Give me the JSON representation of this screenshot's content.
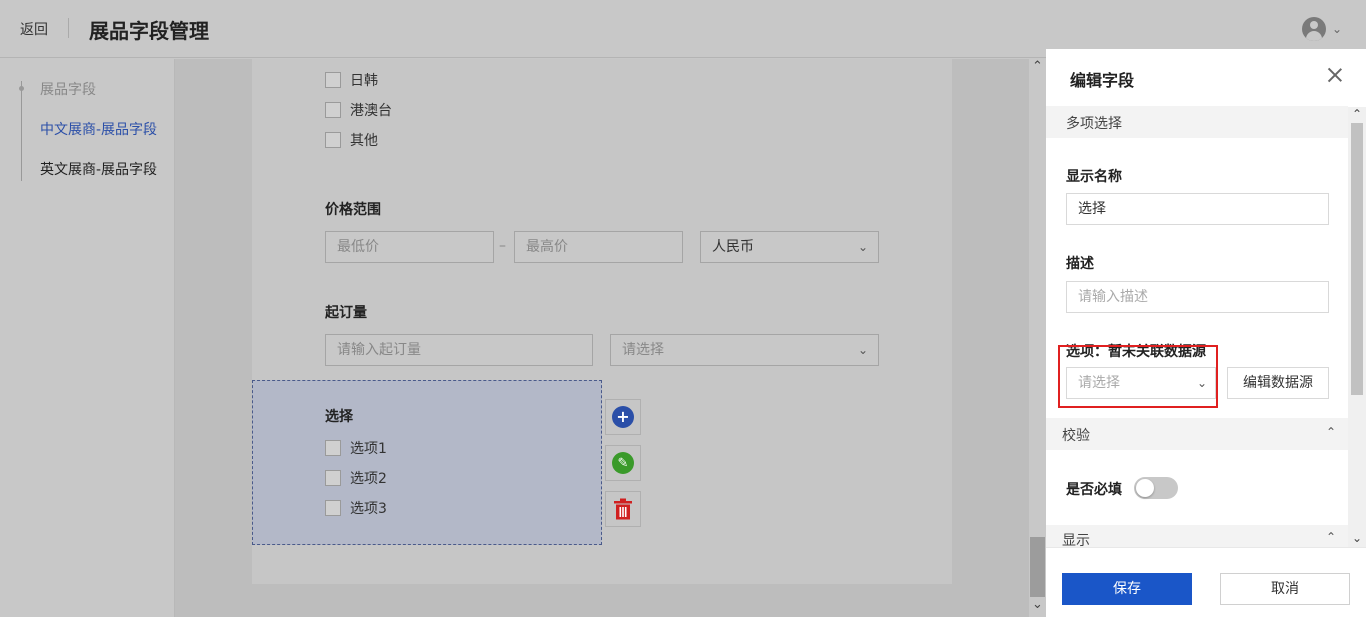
{
  "header": {
    "back_label": "返回",
    "title": "展品字段管理"
  },
  "sidebar": {
    "items": [
      {
        "label": "展品字段",
        "color": "#888888"
      },
      {
        "label": "中文展商-展品字段",
        "color": "#2b4fa8"
      },
      {
        "label": "英文展商-展品字段",
        "color": "#222222"
      }
    ]
  },
  "canvas": {
    "region_options": [
      "日韩",
      "港澳台",
      "其他"
    ],
    "price_range": {
      "label": "价格范围",
      "min_placeholder": "最低价",
      "separator": "–",
      "max_placeholder": "最高价",
      "currency": "人民币"
    },
    "moq": {
      "label": "起订量",
      "placeholder": "请输入起订量",
      "unit_placeholder": "请选择"
    },
    "select_field": {
      "label": "选择",
      "options": [
        "选项1",
        "选项2",
        "选项3"
      ]
    },
    "tool_icons": {
      "add": "+",
      "edit": "✎",
      "delete": "🗑"
    }
  },
  "drawer": {
    "title": "编辑字段",
    "field_type": "多项选择",
    "display_name": {
      "label": "显示名称",
      "value": "选择"
    },
    "description": {
      "label": "描述",
      "placeholder": "请输入描述"
    },
    "options": {
      "label": "选项：暂未关联数据源",
      "placeholder": "请选择",
      "edit_button": "编辑数据源"
    },
    "validation": {
      "section": "校验",
      "required_label": "是否必填",
      "required": false
    },
    "display": {
      "section": "显示"
    },
    "save_label": "保存",
    "cancel_label": "取消"
  },
  "colors": {
    "primary": "#1a56c8",
    "add_icon": "#2b4fa8",
    "edit_icon": "#3a9a2a",
    "delete_icon": "#d02020",
    "highlight": "#e02020"
  }
}
